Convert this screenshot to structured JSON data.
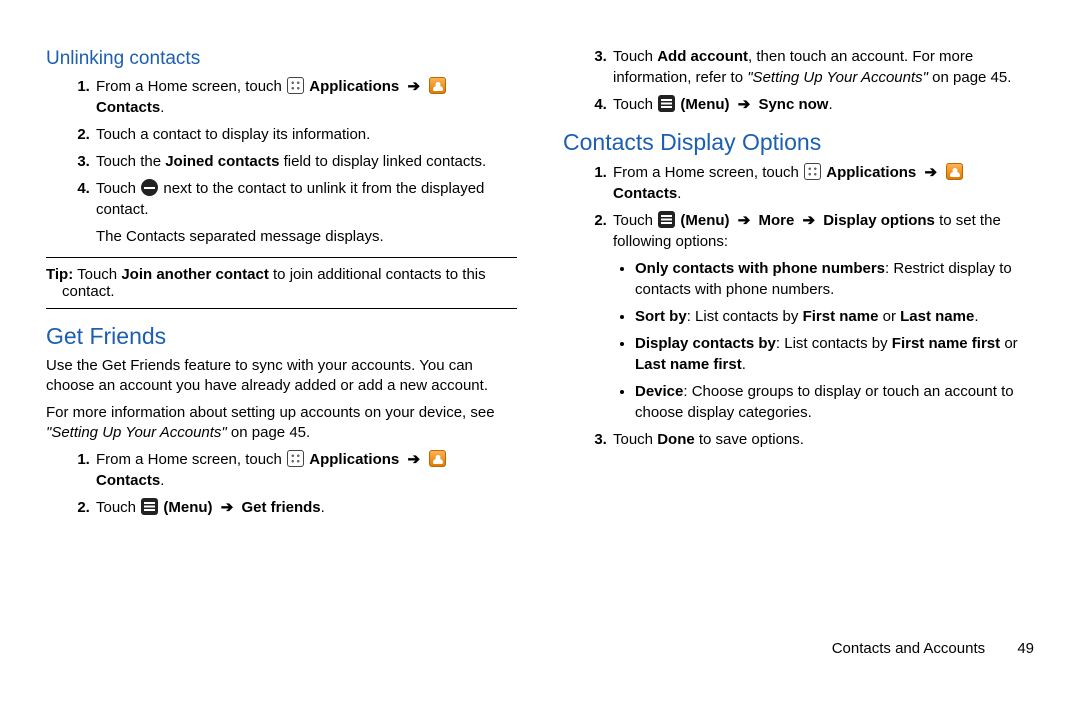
{
  "headings": {
    "unlinking": "Unlinking contacts",
    "get_friends": "Get Friends",
    "display_opts": "Contacts Display Options"
  },
  "labels": {
    "applications": "Applications",
    "contacts": "Contacts",
    "menu": "(Menu)",
    "arrow": "➔"
  },
  "unlink": {
    "s1a": "From a Home screen, touch ",
    "s1b_apps": "Applications",
    "s1c_contacts": "Contacts",
    "s1d": ".",
    "s2": "Touch a contact to display its information.",
    "s3a": "Touch the ",
    "s3b": "Joined contacts",
    "s3c": " field to display linked contacts.",
    "s4a": "Touch ",
    "s4b": " next to the contact to unlink it from the displayed contact.",
    "s4c": "The Contacts separated message displays."
  },
  "tip": {
    "label": "Tip:",
    "a": " Touch ",
    "b": "Join another contact",
    "c": " to join additional contacts to this contact."
  },
  "getfriends": {
    "p1": "Use the Get Friends feature to sync with your accounts. You can choose an account you have already added or add a new account.",
    "p2a": "For more information about setting up accounts on your device, see ",
    "p2b": "\"Setting Up Your Accounts\"",
    "p2c": " on page 45.",
    "s1a": "From a Home screen, touch ",
    "s2a": "Touch ",
    "s2b": "Get friends",
    "s2c": "."
  },
  "col2top": {
    "s3a": "Touch ",
    "s3b": "Add account",
    "s3c": ", then touch an account. For more information, refer to ",
    "s3d": "\"Setting Up Your Accounts\"",
    "s3e": "  on page 45.",
    "s4a": "Touch ",
    "s4b": "Sync now",
    "s4c": "."
  },
  "display": {
    "s1a": "From a Home screen, touch ",
    "s2a": "Touch ",
    "s2b": "More",
    "s2c": "Display options",
    "s2d": " to set the following options:",
    "b1a": "Only contacts with phone numbers",
    "b1b": ": Restrict display to contacts with phone numbers.",
    "b2a": "Sort by",
    "b2b": ": List contacts by ",
    "b2c": "First name",
    "b2d": " or ",
    "b2e": "Last name",
    "b2f": ".",
    "b3a": "Display contacts by",
    "b3b": ": List contacts by ",
    "b3c": "First name first",
    "b3d": " or ",
    "b3e": "Last name first",
    "b3f": ".",
    "b4a": "Device",
    "b4b": ": Choose groups to display or touch an account to choose display categories.",
    "s3a": "Touch ",
    "s3b": "Done",
    "s3c": " to save options."
  },
  "footer": {
    "section": "Contacts and Accounts",
    "page": "49"
  }
}
